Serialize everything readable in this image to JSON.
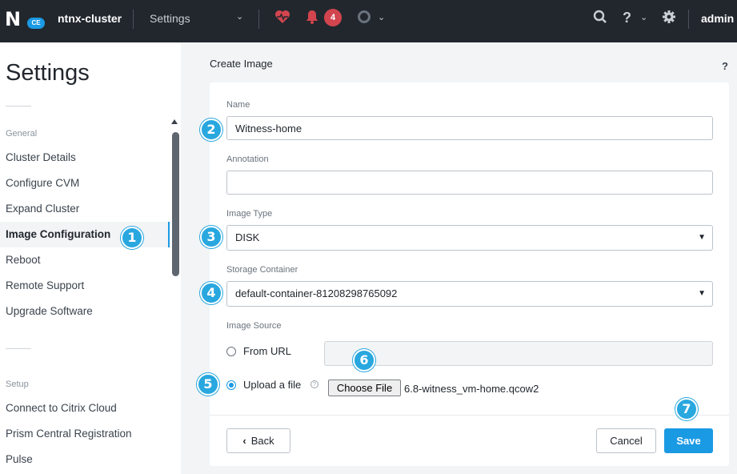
{
  "topbar": {
    "logo_letter": "N",
    "logo_badge": "CE",
    "cluster_name": "ntnx-cluster",
    "section": "Settings",
    "alert_count": "4",
    "user": "admin",
    "icons": [
      "health-heart-icon",
      "alerts-bell-icon",
      "tasks-circle-icon",
      "search-icon",
      "help-icon",
      "gear-icon"
    ]
  },
  "sidebar": {
    "title": "Settings",
    "groups": [
      {
        "label": "General",
        "items": [
          "Cluster Details",
          "Configure CVM",
          "Expand Cluster",
          "Image Configuration",
          "Reboot",
          "Remote Support",
          "Upgrade Software"
        ]
      },
      {
        "label": "Setup",
        "items": [
          "Connect to Citrix Cloud",
          "Prism Central Registration",
          "Pulse"
        ]
      }
    ],
    "active_item": "Image Configuration"
  },
  "panel": {
    "title": "Create Image",
    "help": "?"
  },
  "form": {
    "name_label": "Name",
    "name_value": "Witness-home",
    "annotation_label": "Annotation",
    "annotation_value": "",
    "image_type_label": "Image Type",
    "image_type_value": "DISK",
    "storage_label": "Storage Container",
    "storage_value": "default-container-81208298765092",
    "source_label": "Image Source",
    "source_url_label": "From URL",
    "source_upload_label": "Upload a file",
    "selected_source": "upload",
    "choose_file_label": "Choose File",
    "file_name": "6.8-witness_vm-home.qcow2",
    "info_glyph": "?"
  },
  "buttons": {
    "back": "Back",
    "cancel": "Cancel",
    "save": "Save"
  },
  "steps": [
    "1",
    "2",
    "3",
    "4",
    "5",
    "6",
    "7"
  ],
  "colors": {
    "topbar": "#22272e",
    "accent": "#1b9ae4",
    "step_marker": "#29a7df",
    "alert": "#d2454e"
  }
}
